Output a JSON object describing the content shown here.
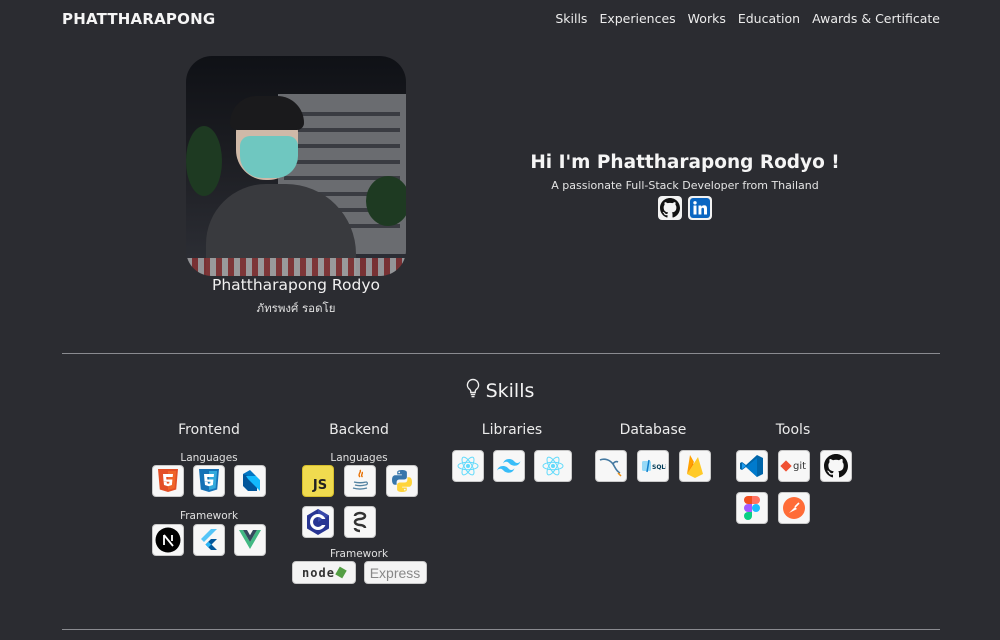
{
  "nav": {
    "brand": "PHATTHARAPONG",
    "links": [
      "Skills",
      "Experiences",
      "Works",
      "Education",
      "Awards & Certificate"
    ]
  },
  "profile": {
    "name_en": "Phattharapong Rodyo",
    "name_th": "ภัทรพงศ์ รอดโย"
  },
  "hero": {
    "greeting": "Hi I'm Phattharapong Rodyo !",
    "tagline": "A passionate Full-Stack Developer from Thailand",
    "social": [
      "github-icon",
      "linkedin-icon"
    ]
  },
  "skills": {
    "title": "Skills",
    "frontend": {
      "title": "Frontend",
      "languages_label": "Languages",
      "languages": [
        "html5-icon",
        "css3-icon",
        "dart-icon"
      ],
      "framework_label": "Framework",
      "frameworks": [
        "nextjs-icon",
        "flutter-icon",
        "vue-icon"
      ]
    },
    "backend": {
      "title": "Backend",
      "languages_label": "Languages",
      "languages": [
        "javascript-icon",
        "java-icon",
        "python-icon",
        "c-icon",
        "sequelize-icon"
      ],
      "framework_label": "Framework",
      "frameworks": [
        "nodejs-icon",
        "express-icon"
      ],
      "node_text": "node",
      "express_text": "Express"
    },
    "libraries": {
      "title": "Libraries",
      "items": [
        "react-icon",
        "tailwind-icon",
        "react-native-icon"
      ]
    },
    "database": {
      "title": "Database",
      "items": [
        "mysql-icon",
        "sqlite-icon",
        "firebase-icon"
      ]
    },
    "tools": {
      "title": "Tools",
      "items": [
        "vscode-icon",
        "git-icon",
        "github-icon",
        "figma-icon",
        "postman-icon"
      ],
      "git_text": "git"
    }
  },
  "colors": {
    "background": "#2b2c31",
    "text": "#e9e9ea",
    "divider": "#8a8b90"
  }
}
